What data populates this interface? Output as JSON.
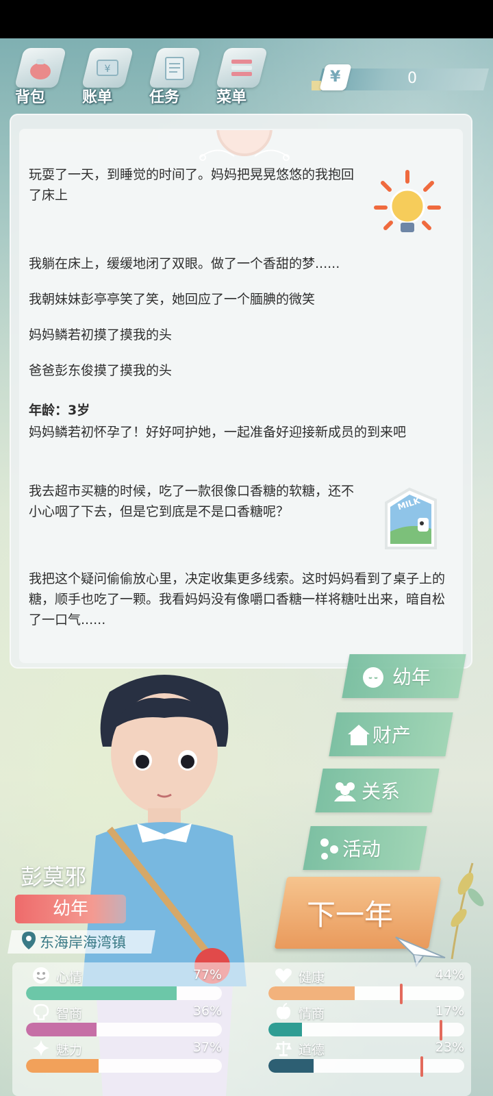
{
  "nav": {
    "items": [
      {
        "label": "背包",
        "icon": "bag-icon"
      },
      {
        "label": "账单",
        "icon": "bill-icon"
      },
      {
        "label": "任务",
        "icon": "task-icon"
      },
      {
        "label": "菜单",
        "icon": "menu-icon"
      }
    ]
  },
  "money": {
    "symbol": "¥",
    "value": "0"
  },
  "story": {
    "p1": "玩耍了一天，到睡觉的时间了。妈妈把晃晃悠悠的我抱回了床上",
    "p2": "我躺在床上，缓缓地闭了双眼。做了一个香甜的梦......",
    "p3": "我朝妹妹彭亭亭笑了笑，她回应了一个腼腆的微笑",
    "p4": "妈妈鳞若初摸了摸我的头",
    "p5": "爸爸彭东俊摸了摸我的头",
    "age_label": "年龄：3岁",
    "p6": "妈妈鳞若初怀孕了！好好呵护她，一起准备好迎接新成员的到来吧",
    "p7": "我去超市买糖的时候，吃了一款很像口香糖的软糖，还不小心咽了下去，但是它到底是不是口香糖呢？",
    "p8": "我把这个疑问偷偷放心里，决定收集更多线索。这时妈妈看到了桌子上的糖，顺手也吃了一颗。我看妈妈没有像嚼口香糖一样将糖吐出来，暗自松了一口气......",
    "milk_label": "MILK"
  },
  "side_menu": {
    "youth": "幼年",
    "assets": "财产",
    "relations": "关系",
    "activities": "活动"
  },
  "next_year": "下一年",
  "player": {
    "name": "彭莫邪",
    "stage": "幼年",
    "location": "东海岸海湾镇"
  },
  "stats": [
    {
      "label": "心情",
      "percent": "77%",
      "value": 0.77,
      "color": "#6cc7a8",
      "icon": "smile-icon"
    },
    {
      "label": "健康",
      "percent": "44%",
      "value": 0.44,
      "color": "#f2b27c",
      "icon": "heart-icon"
    },
    {
      "label": "智商",
      "percent": "36%",
      "value": 0.36,
      "color": "#c66fa6",
      "icon": "brain-icon"
    },
    {
      "label": "情商",
      "percent": "17%",
      "value": 0.17,
      "color": "#2f9d93",
      "icon": "apple-icon"
    },
    {
      "label": "魅力",
      "percent": "37%",
      "value": 0.37,
      "color": "#f2a15a",
      "icon": "sparkle-icon"
    },
    {
      "label": "道德",
      "percent": "23%",
      "value": 0.23,
      "color": "#2d5f73",
      "icon": "scale-icon"
    }
  ]
}
